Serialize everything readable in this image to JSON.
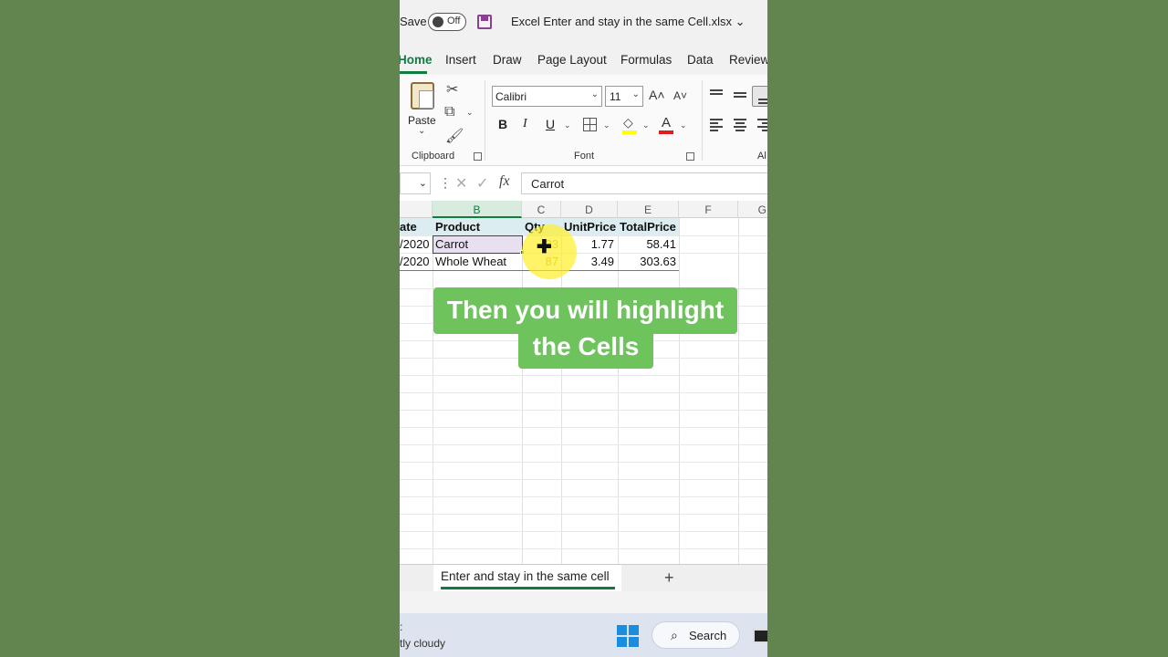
{
  "titlebar": {
    "autosave_label": "Save",
    "autosave_state": "Off",
    "document_title": "Excel Enter and stay in the same Cell.xlsx ⌄"
  },
  "ribbon_tabs": [
    "Home",
    "Insert",
    "Draw",
    "Page Layout",
    "Formulas",
    "Data",
    "Review"
  ],
  "ribbon": {
    "paste_label": "Paste",
    "clipboard_group": "Clipboard",
    "font_name": "Calibri",
    "font_size": "11",
    "grow_font": "A˄",
    "shrink_font": "A˅",
    "bold": "B",
    "italic": "I",
    "underline": "U",
    "font_color_glyph": "A",
    "font_group": "Font",
    "alignment_group": "Al"
  },
  "formula_bar": {
    "fx": "fx",
    "value": "Carrot"
  },
  "columns": [
    "B",
    "C",
    "D",
    "E",
    "F",
    "G"
  ],
  "table": {
    "headers": [
      "ate",
      "Product",
      "Qty",
      "UnitPrice",
      "TotalPrice"
    ],
    "rows": [
      [
        "/2020",
        "Carrot",
        "33",
        "1.77",
        "58.41"
      ],
      [
        "/2020",
        "Whole Wheat",
        "87",
        "3.49",
        "303.63"
      ]
    ]
  },
  "caption": {
    "line1": "Then you will highlight",
    "line2": "the Cells"
  },
  "sheet_tab": "Enter and stay in the same cell",
  "add_sheet": "+",
  "taskbar": {
    "weather": "tly cloudy",
    "search_label": "Search"
  },
  "colors": {
    "accent": "#107c41",
    "caption_bg": "#6ec35d",
    "background": "#62854f",
    "highlight": "#fff028"
  }
}
